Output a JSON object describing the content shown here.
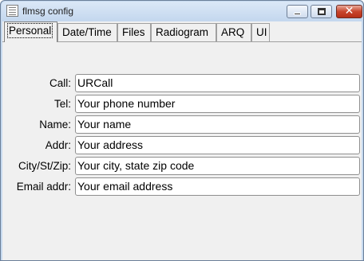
{
  "window": {
    "title": "flmsg config"
  },
  "tabs": [
    {
      "label": "Personal"
    },
    {
      "label": "Date/Time"
    },
    {
      "label": "Files"
    },
    {
      "label": "Radiogram"
    },
    {
      "label": "ARQ"
    },
    {
      "label": "UI"
    }
  ],
  "fields": [
    {
      "label": "Call:",
      "value": "URCall"
    },
    {
      "label": "Tel:",
      "value": "Your phone number"
    },
    {
      "label": "Name:",
      "value": "Your name"
    },
    {
      "label": "Addr:",
      "value": "Your address"
    },
    {
      "label": "City/St/Zip:",
      "value": "Your city, state zip code"
    },
    {
      "label": "Email addr:",
      "value": "Your email address"
    }
  ],
  "icons": {
    "app": "app-icon",
    "minimize": "minimize-icon",
    "maximize": "maximize-icon",
    "close": "close-icon"
  },
  "colors": {
    "titlebar": "#c6d9ef",
    "close_button": "#c8452c",
    "panel_background": "#f0f0f0"
  }
}
